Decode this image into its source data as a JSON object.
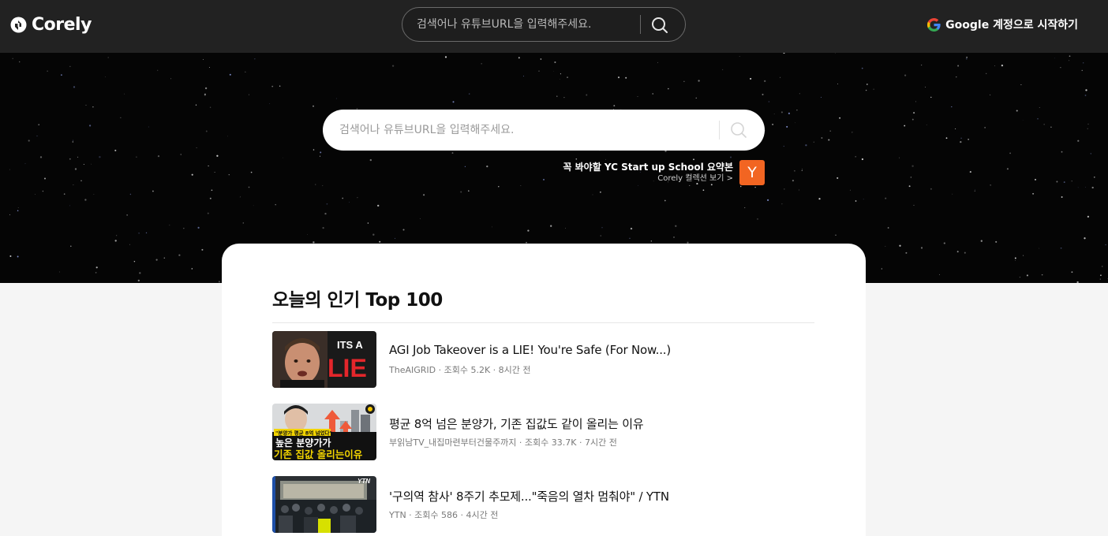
{
  "app": {
    "name": "Corely"
  },
  "header": {
    "search_placeholder": "검색어나 유튜브URL을 입력해주세요.",
    "login_label": "Google 계정으로 시작하기"
  },
  "hero": {
    "search_placeholder": "검색어나 유튜브URL을 입력해주세요.",
    "promo": {
      "title": "꼭 봐야할 YC Start up School 요약본",
      "subtitle": "Corely 컬렉션 보기 >",
      "badge": "Y"
    }
  },
  "popular": {
    "title": "오늘의 인기 Top 100",
    "items": [
      {
        "title": "AGI Job Takeover is a LIE! You're Safe (For Now...)",
        "meta": "TheAIGRID · 조회수 5.2K · 8시간 전",
        "thumb_text_1": "ITS A",
        "thumb_text_2": "LIE"
      },
      {
        "title": "평균 8억 넘은 분양가, 기존 집값도 같이 올리는 이유",
        "meta": "부읽남TV_내집마련부터건물주까지 · 조회수 33.7K · 7시간 전",
        "thumb_text_1": "\"분양가 평균 8억 넘었다\"",
        "thumb_text_2": "높은 분양가가",
        "thumb_text_3": "기존 집값 올리는이유"
      },
      {
        "title": "'구의역 참사' 8주기 추모제...\"죽음의 열차 멈춰야\" / YTN",
        "meta": "YTN · 조회수 586 · 4시간 전",
        "thumb_text_1": "YTN"
      }
    ]
  },
  "colors": {
    "header_bg": "#222222",
    "hero_bg": "#050505",
    "promo_badge": "#f26522",
    "page_bg": "#f5f5f5"
  }
}
